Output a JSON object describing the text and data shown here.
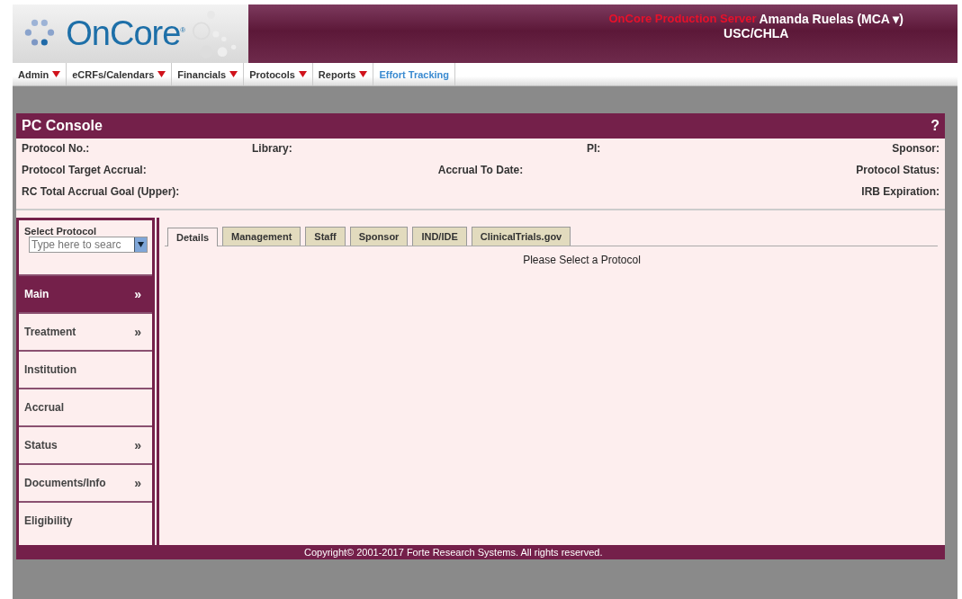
{
  "header": {
    "logo": "OnCore$^{®}$",
    "server": "OnCore Production Server",
    "user": "Amanda Ruelas (MCA ▾)",
    "org": "USC/CHLA"
  },
  "menu": [
    {
      "label": "Admin",
      "kind": "dropdown"
    },
    {
      "label": "eCRFs/Calendars",
      "kind": "dropdown"
    },
    {
      "label": "Financials",
      "kind": "dropdown"
    },
    {
      "label": "Protocols",
      "kind": "dropdown"
    },
    {
      "label": "Reports",
      "kind": "dropdown"
    },
    {
      "label": "Effort Tracking",
      "kind": "link"
    }
  ],
  "console": {
    "title": "PC Console",
    "help": "?",
    "info_rows": [
      [
        "Protocol No.:",
        "Library:",
        "PI:",
        "Sponsor:"
      ],
      [
        "Protocol Target Accrual:",
        "Accrual To Date:",
        "Protocol Status:"
      ],
      [
        "RC Total Accrual Goal (Upper):",
        "IRB Expiration:"
      ]
    ]
  },
  "sidebar": {
    "search_label": "Select Protocol",
    "search": {
      "placeholder": "Type here to searc"
    },
    "items": [
      {
        "label": "Main",
        "selected": true,
        "arrow": "»"
      },
      {
        "label": "Treatment",
        "selected": false,
        "arrow": "»"
      },
      {
        "label": "Institution",
        "selected": false
      },
      {
        "label": "Accrual",
        "selected": false
      },
      {
        "label": "Status",
        "selected": false,
        "arrow": "»"
      },
      {
        "label": "Documents/Info",
        "selected": false,
        "arrow": "»"
      },
      {
        "label": "Eligibility",
        "selected": false
      }
    ]
  },
  "tabs": [
    {
      "label": "Details",
      "selected": true
    },
    {
      "label": "Management",
      "selected": false
    },
    {
      "label": "Staff",
      "selected": false
    },
    {
      "label": "Sponsor",
      "selected": false
    },
    {
      "label": "IND/IDE",
      "selected": false
    },
    {
      "label": "ClinicalTrials.gov",
      "selected": false
    }
  ],
  "message": "Please Select a Protocol",
  "footer": "Copyright© 2001-2017 Forte Research Systems. All rights reserved."
}
